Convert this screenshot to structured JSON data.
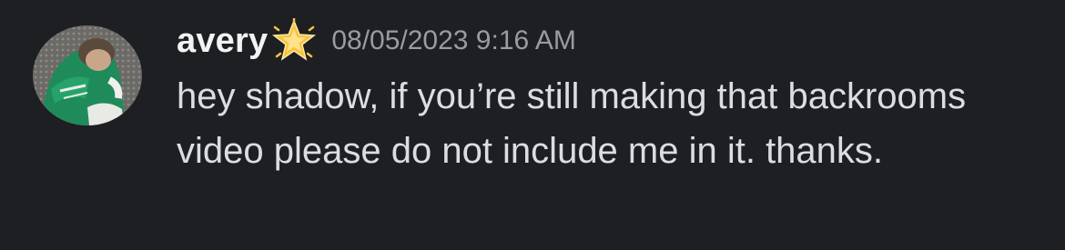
{
  "message": {
    "author": "avery",
    "badge_icon": "glowing-star-icon",
    "timestamp": "08/05/2023 9:16 AM",
    "text": "hey shadow, if you’re still making that backrooms video please do not include me in it. thanks."
  },
  "colors": {
    "background": "#1e1f22",
    "username": "#f2f3f5",
    "timestamp": "#9a9ba3",
    "text": "#dcdde1",
    "badge": "#f5c542"
  }
}
